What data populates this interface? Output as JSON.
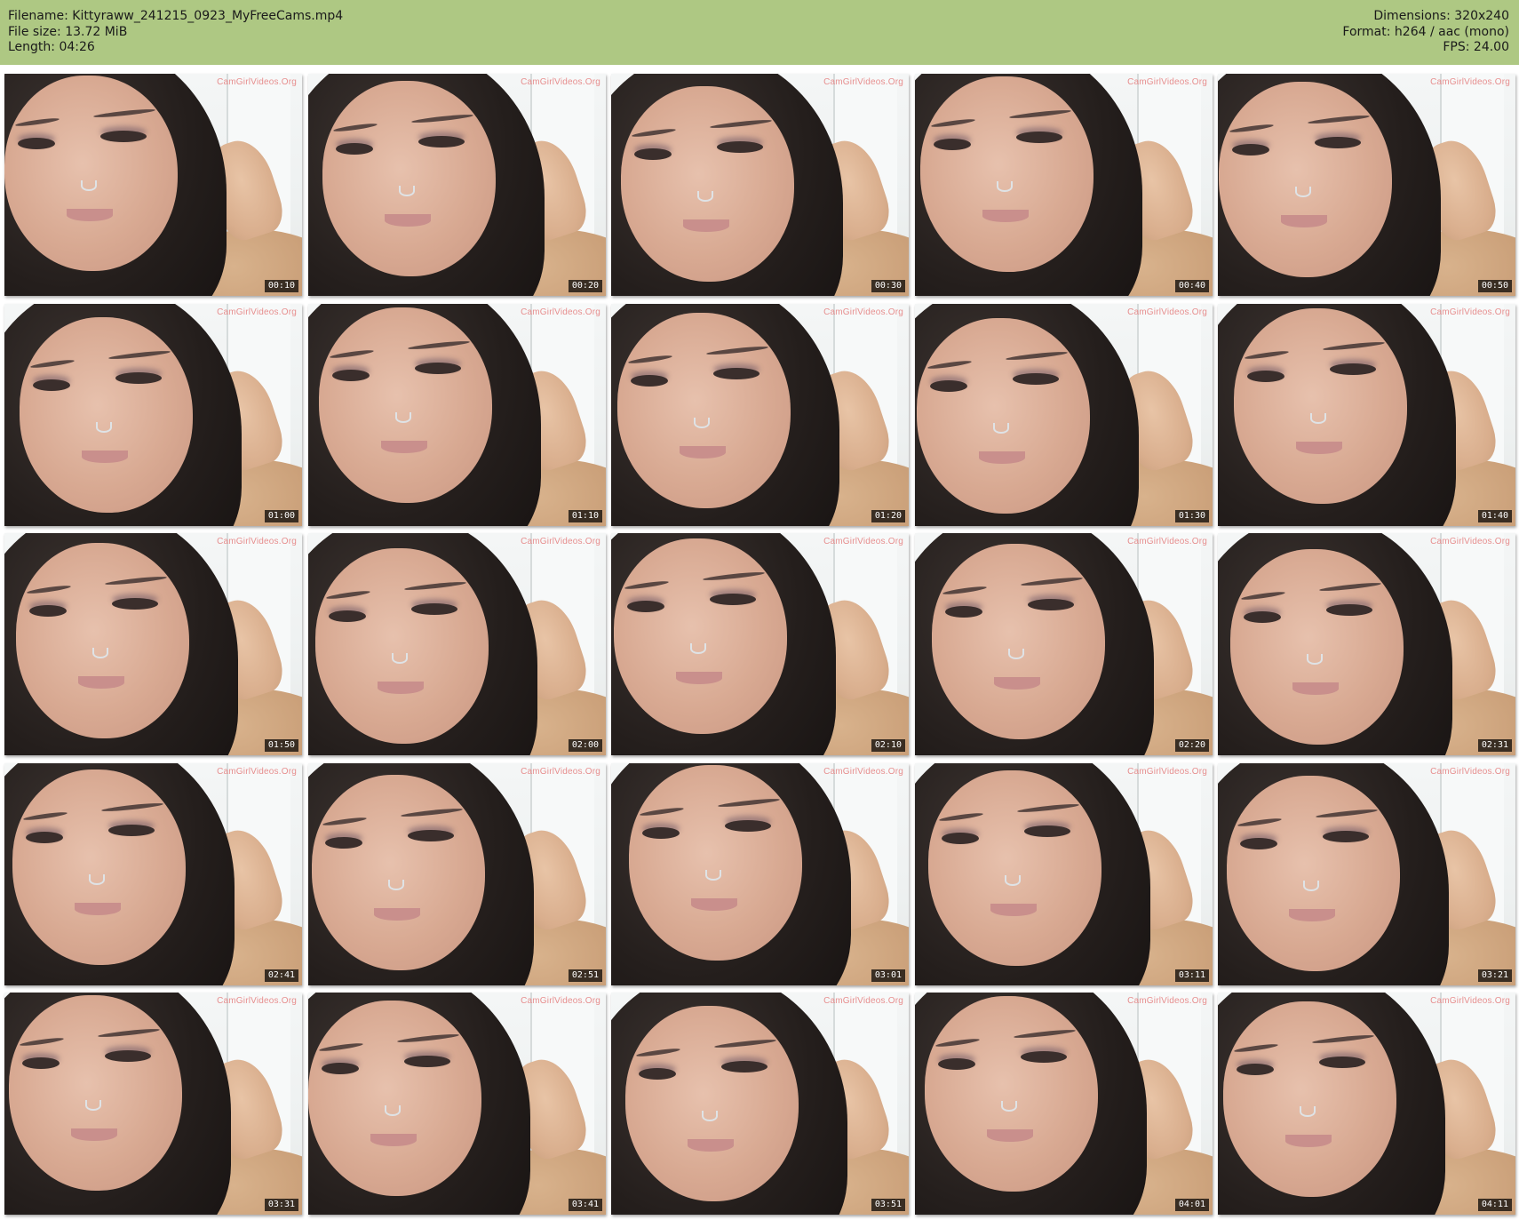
{
  "header": {
    "filename_label": "Filename: Kittyraww_241215_0923_MyFreeCams.mp4",
    "filesize_label": "File size: 13.72 MiB",
    "length_label": "Length: 04:26",
    "dimensions_label": "Dimensions: 320x240",
    "format_label": "Format: h264 / aac (mono)",
    "fps_label": "FPS: 24.00",
    "background_color": "#aec883"
  },
  "watermark": "CamGirlVideos.Org",
  "thumbnails": [
    {
      "time": "00:10"
    },
    {
      "time": "00:20"
    },
    {
      "time": "00:30"
    },
    {
      "time": "00:40"
    },
    {
      "time": "00:50"
    },
    {
      "time": "01:00"
    },
    {
      "time": "01:10"
    },
    {
      "time": "01:20"
    },
    {
      "time": "01:30"
    },
    {
      "time": "01:40"
    },
    {
      "time": "01:50"
    },
    {
      "time": "02:00"
    },
    {
      "time": "02:10"
    },
    {
      "time": "02:20"
    },
    {
      "time": "02:31"
    },
    {
      "time": "02:41"
    },
    {
      "time": "02:51"
    },
    {
      "time": "03:01"
    },
    {
      "time": "03:11"
    },
    {
      "time": "03:21"
    },
    {
      "time": "03:31"
    },
    {
      "time": "03:41"
    },
    {
      "time": "03:51"
    },
    {
      "time": "04:01"
    },
    {
      "time": "04:11"
    }
  ]
}
